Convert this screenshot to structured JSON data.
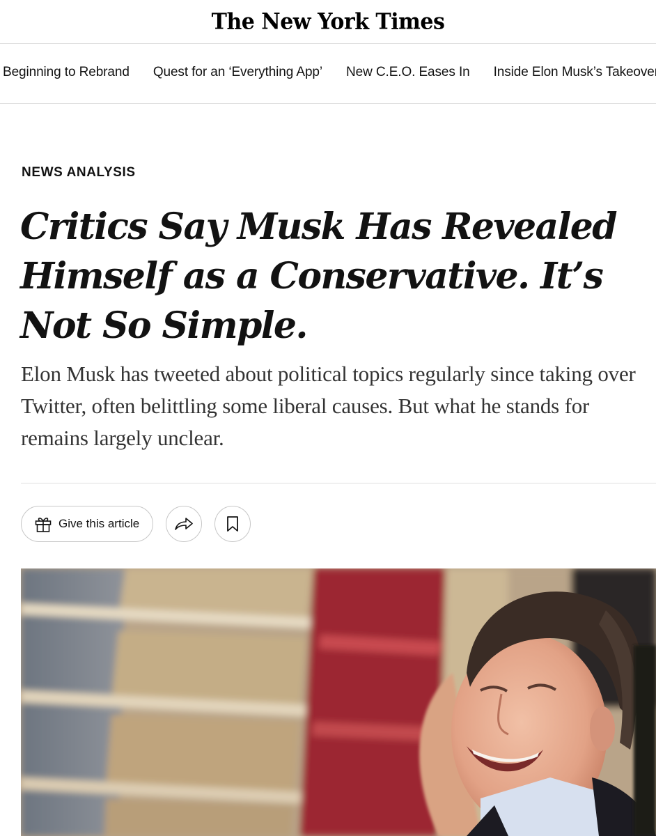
{
  "masthead": {
    "logo": "The New York Times"
  },
  "story_rail": {
    "links": [
      "Beginning to Rebrand",
      "Quest for an ‘Everything App’",
      "New C.E.O. Eases In",
      "Inside Elon Musk’s Takeover"
    ]
  },
  "article": {
    "kicker": "NEWS ANALYSIS",
    "headline": "Critics Say Musk Has Revealed Himself as a Conservative. It’s Not So Simple.",
    "summary": "Elon Musk has tweeted about political topics regularly since taking over Twitter, often belittling some liberal causes. But what he stands for remains largely unclear."
  },
  "share_tools": {
    "give_label": "Give this article",
    "icons": [
      "gift-icon",
      "share-icon",
      "bookmark-icon"
    ]
  },
  "colors": {
    "text": "#121212",
    "summary_text": "#333333",
    "divider": "#dfdfdf",
    "button_border": "#c7c7c7"
  }
}
